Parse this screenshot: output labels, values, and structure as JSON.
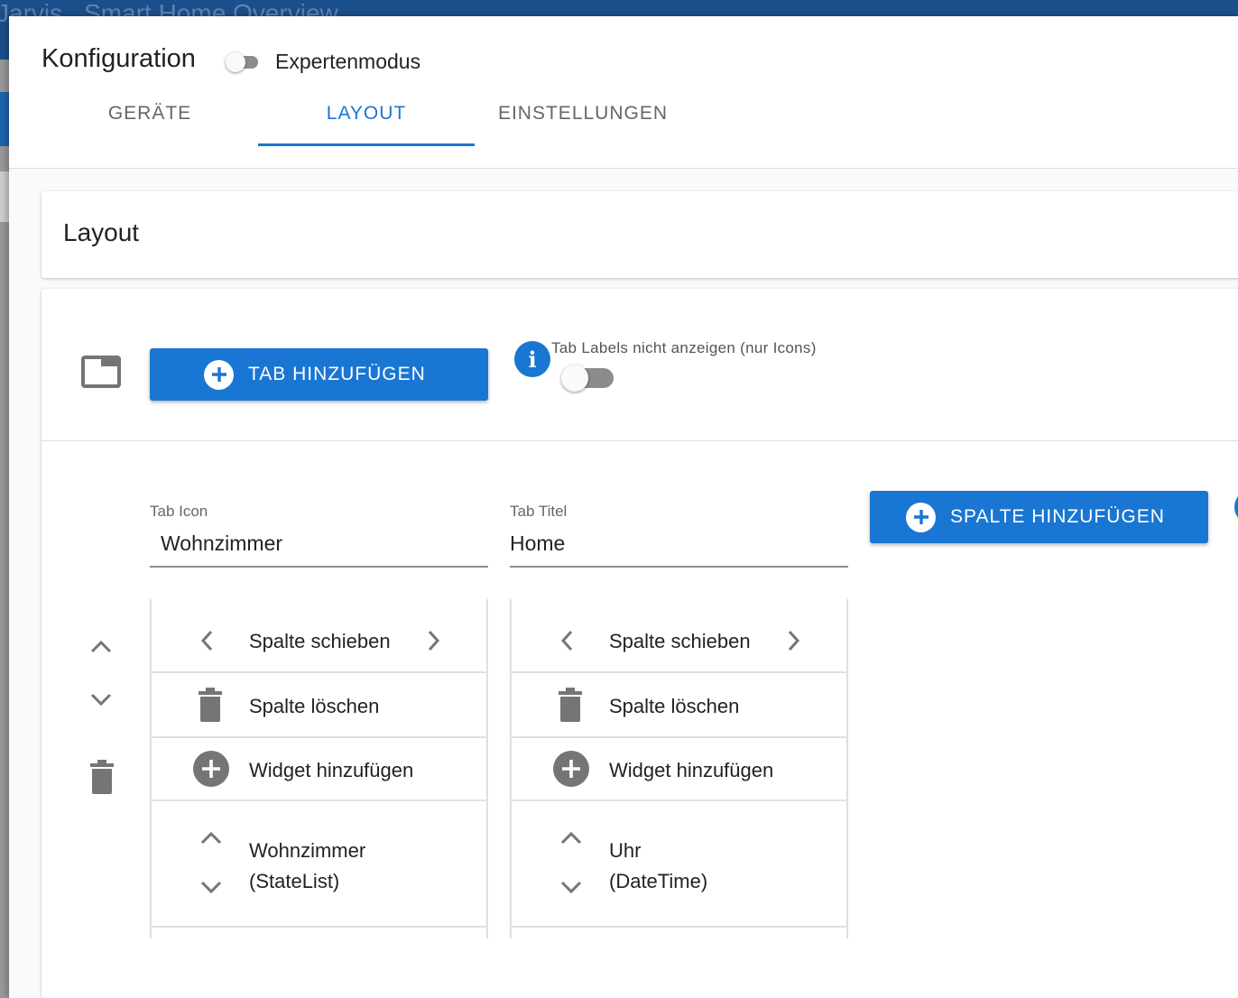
{
  "background": {
    "app_title": "Jarvis",
    "page_title": "Smart Home Overview"
  },
  "dialog": {
    "title": "Konfiguration",
    "expert_mode_label": "Expertenmodus",
    "expert_mode_on": false,
    "tabs": [
      {
        "label": "GERÄTE",
        "active": false
      },
      {
        "label": "LAYOUT",
        "active": true
      },
      {
        "label": "EINSTELLUNGEN",
        "active": false
      }
    ]
  },
  "layout_section": {
    "title": "Layout",
    "add_tab_label": "TAB HINZUFÜGEN",
    "hide_tab_labels_text": "Tab Labels nicht anzeigen (nur Icons)",
    "hide_tab_labels_on": false,
    "tab_icon": {
      "label": "Tab Icon",
      "value": "Wohnzimmer"
    },
    "tab_title": {
      "label": "Tab Titel",
      "value": "Home"
    },
    "add_column_label": "SPALTE HINZUFÜGEN",
    "columns": [
      {
        "move_label": "Spalte schieben",
        "delete_label": "Spalte löschen",
        "add_widget_label": "Widget hinzufügen",
        "widget_name": "Wohnzimmer",
        "widget_type": "(StateList)"
      },
      {
        "move_label": "Spalte schieben",
        "delete_label": "Spalte löschen",
        "add_widget_label": "Widget hinzufügen",
        "widget_name": "Uhr",
        "widget_type": "(DateTime)"
      }
    ]
  },
  "colors": {
    "primary": "#1976d2",
    "appbar": "#1b4f8c",
    "icon_grey": "#757575"
  }
}
